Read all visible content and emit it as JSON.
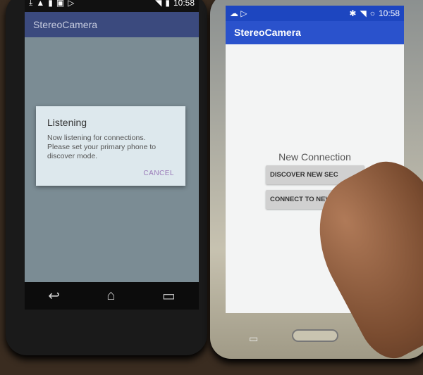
{
  "left_phone": {
    "status": {
      "time": "10:58",
      "icons": [
        "download-icon",
        "warning-icon",
        "sd-card-icon",
        "image-icon",
        "phone-icon",
        "app-icon",
        "play-icon",
        "play-store-icon",
        "bluetooth-icon",
        "wifi-icon",
        "signal-icon",
        "battery-icon"
      ]
    },
    "app_title": "StereoCamera",
    "dialog": {
      "title": "Listening",
      "message": "Now listening for connections.\nPlease set your primary phone to discover mode.",
      "cancel": "CANCEL"
    },
    "nav": {
      "back": "↩",
      "home": "⌂",
      "recents": "▭"
    }
  },
  "right_phone": {
    "status": {
      "time": "10:58"
    },
    "app_title": "StereoCamera",
    "heading": "New Connection",
    "buttons": [
      "DISCOVER NEW SEC",
      "CONNECT TO NEW PR"
    ]
  }
}
